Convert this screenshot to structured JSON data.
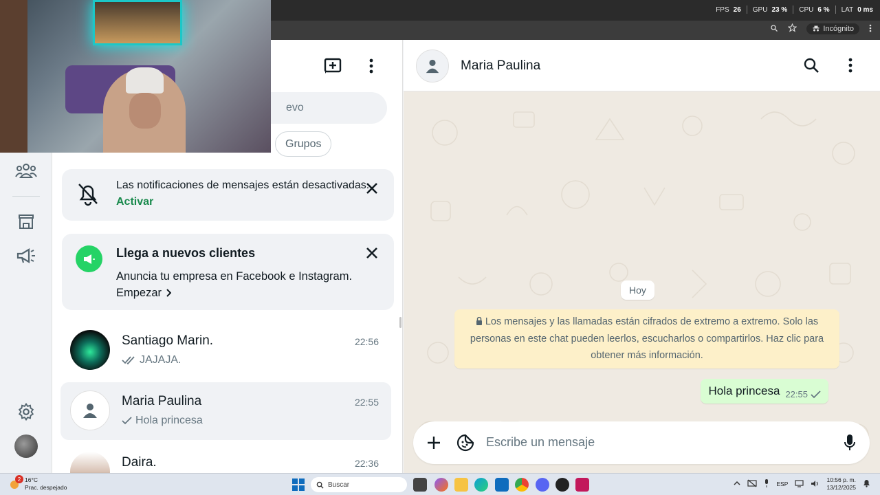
{
  "perf": {
    "fps_label": "FPS",
    "fps": "26",
    "gpu_label": "GPU",
    "gpu": "23 %",
    "cpu_label": "CPU",
    "cpu": "6 %",
    "lat_label": "LAT",
    "lat": "0 ms"
  },
  "browser": {
    "incognito_label": "Incógnito"
  },
  "list": {
    "search_placeholder_fragment": "evo",
    "chip_groups": "Grupos",
    "notif_card": {
      "text": "Las notificaciones de mensajes están desactivadas.",
      "action": "Activar"
    },
    "promo_card": {
      "title": "Llega a nuevos clientes",
      "body": "Anuncia tu empresa en Facebook e Instagram.",
      "action": "Empezar"
    },
    "chats": [
      {
        "name": "Santiago Marin.",
        "time": "22:56",
        "preview": "JAJAJA."
      },
      {
        "name": "Maria Paulina",
        "time": "22:55",
        "preview": "Hola princesa"
      },
      {
        "name": "Daira.",
        "time": "22:36",
        "preview": ""
      }
    ]
  },
  "conversation": {
    "contact_name": "Maria Paulina",
    "day_label": "Hoy",
    "encryption_note": "Los mensajes y las llamadas están cifrados de extremo a extremo. Solo las personas en este chat pueden leerlos, escucharlos o compartirlos. Haz clic para obtener más información.",
    "message": {
      "text": "Hola princesa",
      "time": "22:55"
    },
    "composer_placeholder": "Escribe un mensaje"
  },
  "taskbar": {
    "weather_badge": "2",
    "temp": "16°C",
    "condition": "Prac. despejado",
    "search_label": "Buscar",
    "lang": "ESP",
    "time": "10:56 p. m.",
    "date": "13/12/2025"
  },
  "colors": {
    "accent_green": "#1a8a4d",
    "promo_icon_bg": "#25d366",
    "bubble_out": "#d9fdd3",
    "enc_note_bg": "#fdf0c9"
  }
}
